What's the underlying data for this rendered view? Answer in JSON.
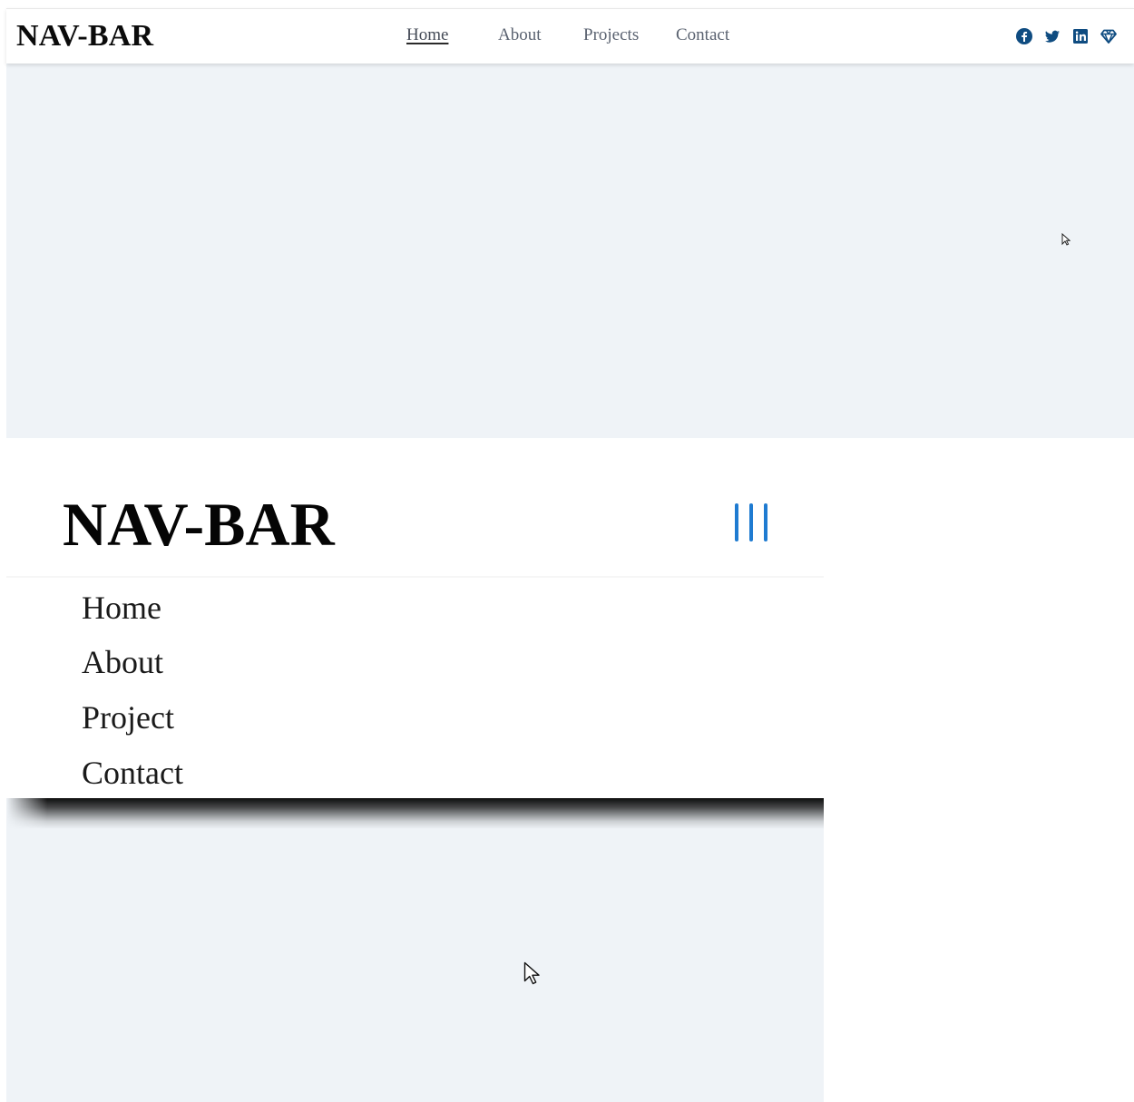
{
  "desktop": {
    "brand": "NAV-BAR",
    "links": [
      {
        "label": "Home",
        "active": true
      },
      {
        "label": "About",
        "active": false
      },
      {
        "label": "Projects",
        "active": false
      },
      {
        "label": "Contact",
        "active": false
      }
    ],
    "social_icons": [
      "facebook-icon",
      "twitter-icon",
      "linkedin-icon",
      "gem-icon"
    ],
    "icon_color": "#0f4c81",
    "background": "#eff3f7"
  },
  "mobile": {
    "brand": "NAV-BAR",
    "menu_icon": "hamburger-icon",
    "menu_icon_color": "#1f7bd1",
    "menu": [
      {
        "label": "Home"
      },
      {
        "label": "About"
      },
      {
        "label": "Project"
      },
      {
        "label": "Contact"
      }
    ]
  }
}
